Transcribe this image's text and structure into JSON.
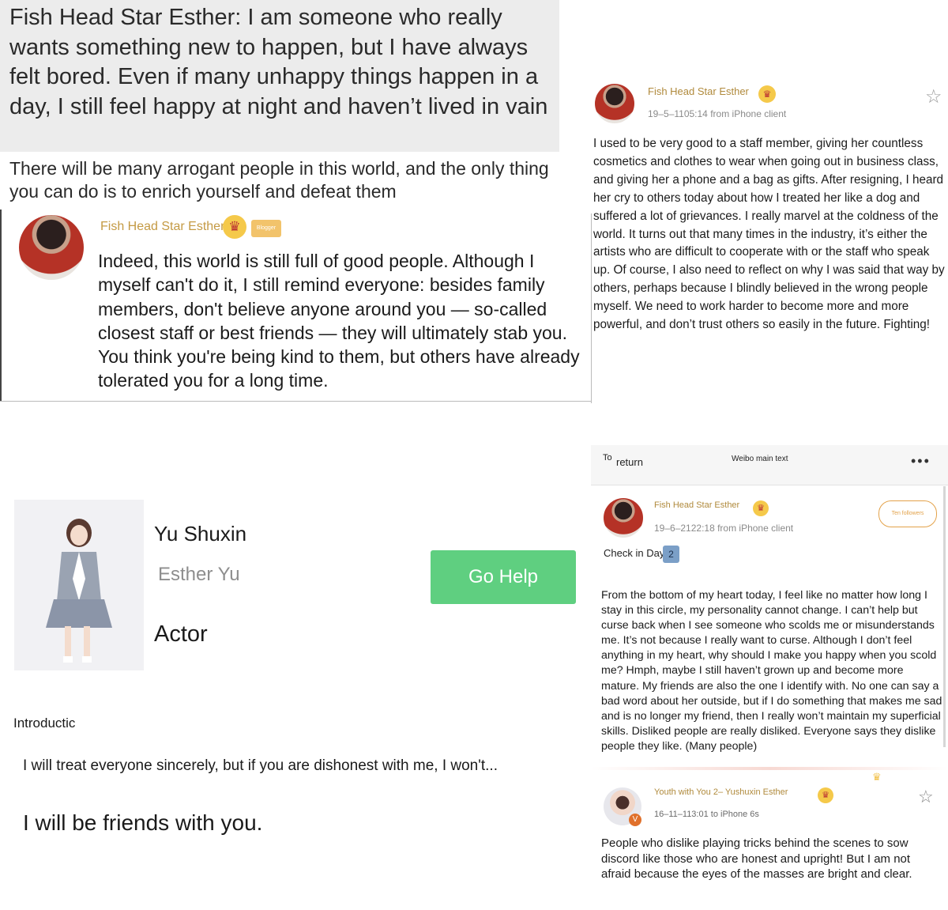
{
  "panel1": {
    "heading": "Fish Head Star Esther: I am someone who really wants something new to happen, but I have always felt bored. Even if many unhappy things happen in a day, I still feel happy at night and haven’t lived in vain",
    "heading2": "There will be many arrogant people in this world, and the only thing you can do is to enrich yourself and defeat them",
    "username": "Fish Head Star Esther",
    "crown_icon": "crown-icon",
    "badge": "Blogger",
    "body": "Indeed, this world is still full of good people. Although I myself can't do it, I still remind everyone: besides family members, don't believe anyone around you — so-called closest staff or best friends — they will ultimately stab you. You think you're being kind to them, but others have already tolerated you for a long time."
  },
  "panel2": {
    "username": "Fish Head Star Esther",
    "meta": "19–5–1105:14 from iPhone client",
    "body": "I used to be very good to a staff member, giving her countless cosmetics and clothes to wear when going out in business class, and giving her a phone and a bag as gifts. After resigning, I heard her cry to others today about how I treated her like a dog and suffered a lot of grievances. I really marvel at the coldness of the world. It turns out that many times in the industry, it’s either the artists who are difficult to cooperate with or the staff who speak up. Of course, I also need to reflect on why I was said that way by others, perhaps because I blindly believed in the wrong people myself. We need to work harder to become more and more powerful, and don’t trust others so easily in the future. Fighting!"
  },
  "panel3": {
    "name_cn": "Yu Shuxin",
    "name_en": "Esther Yu",
    "role": "Actor",
    "button": "Go Help",
    "intro_label": "Introductic",
    "line1": "I will treat everyone sincerely, but if you are dishonest with me, I won't...",
    "line2": "I will be friends with you."
  },
  "panel4": {
    "topbar": {
      "to": "To",
      "return": "return",
      "title": "Weibo main text",
      "more": "•••"
    },
    "post1": {
      "username": "Fish Head Star Esther",
      "meta": "19–6–2122:18 from iPhone client",
      "follow": "Ten followers",
      "checkin": "Check in Day",
      "day": "2",
      "body": "From the bottom of my heart today, I feel like no matter how long I stay in this circle, my personality cannot change. I can’t help but curse back when I see someone who scolds me or misunderstands me. It’s not because I really want to curse. Although I don’t feel anything in my heart, why should I make you happy when you scold me? Hmph, maybe I still haven’t grown up and become more mature. My friends are also the one I identify with. No one can say a bad word about her outside, but if I do something that makes me sad and is no longer my friend, then I really won’t maintain my superficial skills. Disliked people are really disliked. Everyone says they dislike people they like. (Many people)"
    },
    "post2": {
      "username": "Youth with You 2– Yushuxin Esther",
      "meta": "16–11–113:01 to iPhone 6s",
      "verified": "V",
      "body": "People who dislike playing tricks behind the scenes to sow discord like those who are honest and upright! But I am not afraid because the eyes of the masses are bright and clear."
    }
  }
}
